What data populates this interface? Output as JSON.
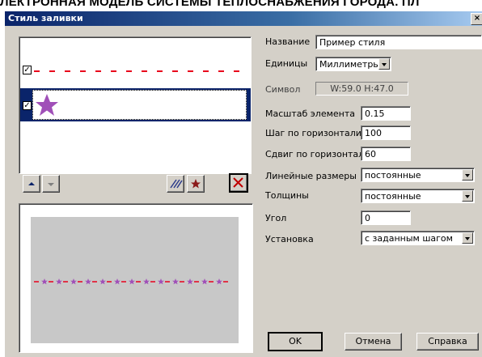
{
  "background": {
    "heading": "ЛЕКТРОННАЯ МОДЕЛЬ СИСТЕМЫ ТЕПЛОСНАБЖЕНИЯ ГОРОДА. ПЛ"
  },
  "window": {
    "title": "Стиль заливки",
    "close_glyph": "×"
  },
  "list": {
    "items": [
      {
        "name": "dashed-line-style",
        "checked": true,
        "selected": false
      },
      {
        "name": "star-symbol-style",
        "checked": true,
        "selected": true
      }
    ]
  },
  "list_toolbar": {
    "move_up_icon": "up-arrow-icon",
    "move_down_icon": "down-arrow-icon",
    "hatch_icon": "hatch-icon",
    "star_icon": "star-icon",
    "delete_icon": "delete-x-icon"
  },
  "form": {
    "name_label": "Название",
    "name_value": "Пример стиля",
    "units_label": "Единицы",
    "units_value": "Миллиметры",
    "symbol_label": "Символ",
    "symbol_value": "W:59.0  H:47.0",
    "scale_label": "Масштаб элемента",
    "scale_value": "0.15",
    "hstep_label": "Шаг по горизонтали",
    "hstep_value": "100",
    "hshift_label": "Сдвиг по горизонтали",
    "hshift_value": "60",
    "linear_label": "Линейные размеры",
    "linear_value": "постоянные",
    "thickness_label": "Толщины",
    "thickness_value": "постоянные",
    "angle_label": "Угол",
    "angle_value": "0",
    "placement_label": "Установка",
    "placement_value": "с заданным шагом"
  },
  "buttons": {
    "ok": "OK",
    "cancel": "Отмена",
    "help": "Справка"
  },
  "colors": {
    "line_red": "#e8001c",
    "star_purple": "#a050b8",
    "selection_navy": "#0a246a"
  }
}
